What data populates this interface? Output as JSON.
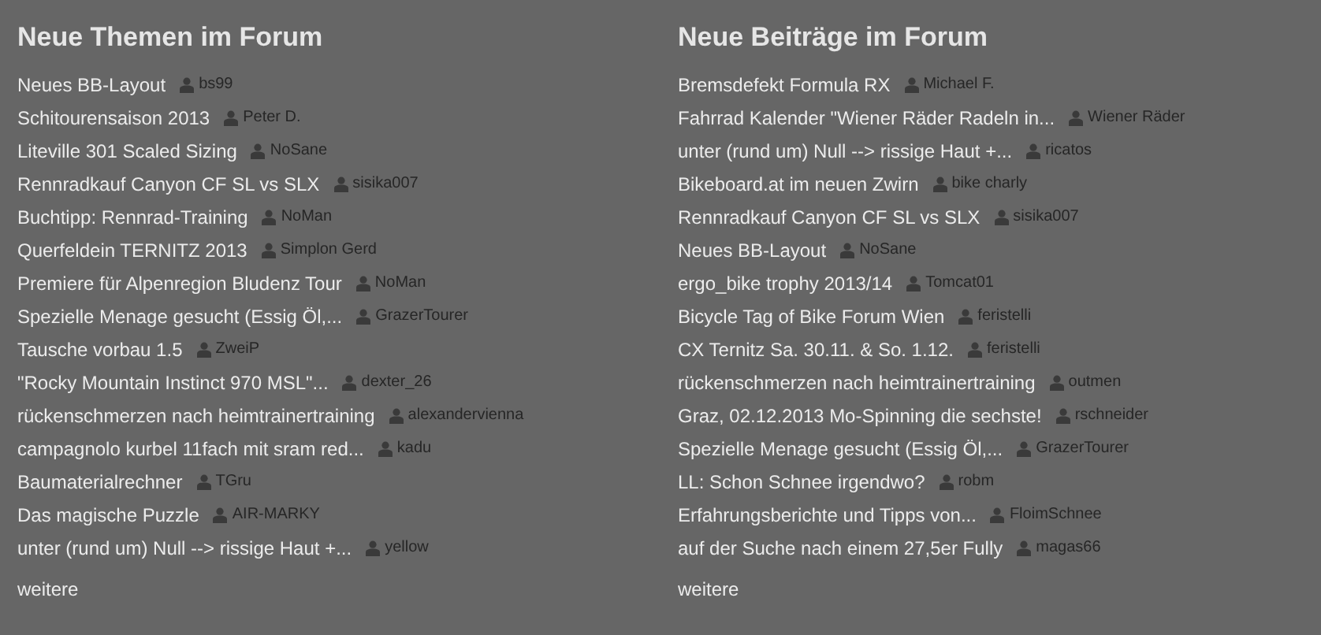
{
  "columns": [
    {
      "title": "Neue Themen im Forum",
      "items": [
        {
          "topic": "Neues BB-Layout",
          "author": "bs99"
        },
        {
          "topic": "Schitourensaison 2013",
          "author": "Peter D."
        },
        {
          "topic": "Liteville 301 Scaled Sizing",
          "author": "NoSane"
        },
        {
          "topic": "Rennradkauf Canyon CF SL vs SLX",
          "author": "sisika007"
        },
        {
          "topic": "Buchtipp: Rennrad-Training",
          "author": "NoMan"
        },
        {
          "topic": "Querfeldein TERNITZ 2013",
          "author": "Simplon Gerd"
        },
        {
          "topic": "Premiere für Alpenregion Bludenz Tour",
          "author": "NoMan"
        },
        {
          "topic": "Spezielle Menage gesucht (Essig Öl,...",
          "author": "GrazerTourer"
        },
        {
          "topic": "Tausche vorbau 1.5",
          "author": "ZweiP"
        },
        {
          "topic": "\"Rocky Mountain Instinct 970 MSL\"...",
          "author": "dexter_26"
        },
        {
          "topic": "rückenschmerzen nach heimtrainertraining",
          "author": "alexandervienna"
        },
        {
          "topic": "campagnolo kurbel 11fach mit sram red...",
          "author": "kadu"
        },
        {
          "topic": "Baumaterialrechner",
          "author": "TGru"
        },
        {
          "topic": "Das magische Puzzle",
          "author": "AIR-MARKY"
        },
        {
          "topic": "unter (rund um) Null --> rissige Haut +...",
          "author": "yellow"
        }
      ],
      "more": "weitere"
    },
    {
      "title": "Neue Beiträge im Forum",
      "items": [
        {
          "topic": "Bremsdefekt Formula RX",
          "author": "Michael F."
        },
        {
          "topic": "Fahrrad Kalender \"Wiener Räder Radeln in...",
          "author": "Wiener Räder"
        },
        {
          "topic": "unter (rund um) Null --> rissige Haut +...",
          "author": "ricatos"
        },
        {
          "topic": "Bikeboard.at im neuen Zwirn",
          "author": "bike charly"
        },
        {
          "topic": "Rennradkauf Canyon CF SL vs SLX",
          "author": "sisika007"
        },
        {
          "topic": "Neues BB-Layout",
          "author": "NoSane"
        },
        {
          "topic": "ergo_bike trophy 2013/14",
          "author": "Tomcat01"
        },
        {
          "topic": "Bicycle Tag of Bike Forum Wien",
          "author": "feristelli"
        },
        {
          "topic": "CX Ternitz Sa. 30.11. & So. 1.12.",
          "author": "feristelli"
        },
        {
          "topic": "rückenschmerzen nach heimtrainertraining",
          "author": "outmen"
        },
        {
          "topic": "Graz, 02.12.2013 Mo-Spinning die sechste!",
          "author": "rschneider"
        },
        {
          "topic": "Spezielle Menage gesucht (Essig Öl,...",
          "author": "GrazerTourer"
        },
        {
          "topic": "LL: Schon Schnee irgendwo?",
          "author": "robm"
        },
        {
          "topic": "Erfahrungsberichte und Tipps von...",
          "author": "FloimSchnee"
        },
        {
          "topic": "auf der Suche nach einem 27,5er Fully",
          "author": "magas66"
        }
      ],
      "more": "weitere"
    }
  ]
}
